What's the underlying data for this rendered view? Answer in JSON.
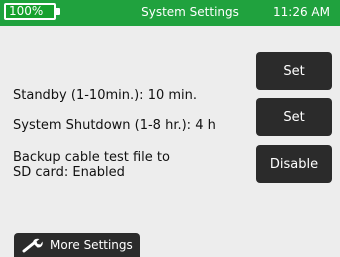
{
  "status_bar": {
    "battery_percent_text": "100%",
    "battery_level": 1.0,
    "title": "System Settings",
    "time": "11:26 AM"
  },
  "settings": [
    {
      "label": "Standby (1-10min.): 10 min.",
      "button": "Set"
    },
    {
      "label": "System Shutdown (1-8 hr.): 4 h",
      "button": "Set"
    },
    {
      "label_line1": "Backup cable test file to",
      "label_line2": "SD card: Enabled",
      "button": "Disable"
    }
  ],
  "more_settings": {
    "label": "More Settings",
    "icon": "wrench-icon"
  },
  "colors": {
    "status_bar": "#20a23e",
    "background": "#ededed",
    "button": "#2b2b2b",
    "button_text": "#ffffff"
  }
}
